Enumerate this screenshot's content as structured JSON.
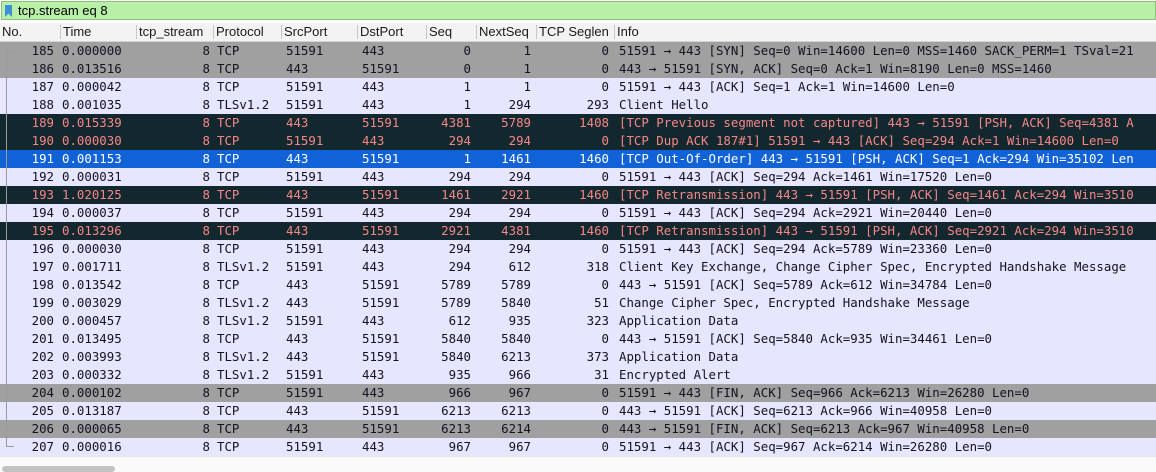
{
  "filter": {
    "value": "tcp.stream eq 8"
  },
  "columns": [
    "No.",
    "Time",
    "tcp_stream",
    "Protocol",
    "SrcPort",
    "DstPort",
    "Seq",
    "NextSeq",
    "TCP Seglen",
    "Info"
  ],
  "colors": {
    "filter_bg": "#b8f0a8",
    "row_normal": "#e7e6ff",
    "row_gray": "#a0a0a0",
    "row_dark": "#12272e",
    "row_dark_text": "#f78787",
    "row_selected": "#1062d6"
  },
  "packets": [
    {
      "no": "185",
      "time": "0.000000",
      "stream": "8",
      "proto": "TCP",
      "src": "51591",
      "dst": "443",
      "seq": "0",
      "next": "1",
      "len": "0",
      "info": "51591 → 443 [SYN] Seq=0 Win=14600 Len=0 MSS=1460 SACK_PERM=1 TSval=21",
      "style": "gray"
    },
    {
      "no": "186",
      "time": "0.013516",
      "stream": "8",
      "proto": "TCP",
      "src": "443",
      "dst": "51591",
      "seq": "0",
      "next": "1",
      "len": "0",
      "info": "443 → 51591 [SYN, ACK] Seq=0 Ack=1 Win=8190 Len=0 MSS=1460",
      "style": "gray"
    },
    {
      "no": "187",
      "time": "0.000042",
      "stream": "8",
      "proto": "TCP",
      "src": "51591",
      "dst": "443",
      "seq": "1",
      "next": "1",
      "len": "0",
      "info": "51591 → 443 [ACK] Seq=1 Ack=1 Win=14600 Len=0",
      "style": "normal"
    },
    {
      "no": "188",
      "time": "0.001035",
      "stream": "8",
      "proto": "TLSv1.2",
      "src": "51591",
      "dst": "443",
      "seq": "1",
      "next": "294",
      "len": "293",
      "info": "Client Hello",
      "style": "normal"
    },
    {
      "no": "189",
      "time": "0.015339",
      "stream": "8",
      "proto": "TCP",
      "src": "443",
      "dst": "51591",
      "seq": "4381",
      "next": "5789",
      "len": "1408",
      "info": "[TCP Previous segment not captured] 443 → 51591 [PSH, ACK] Seq=4381 A",
      "style": "dark"
    },
    {
      "no": "190",
      "time": "0.000030",
      "stream": "8",
      "proto": "TCP",
      "src": "51591",
      "dst": "443",
      "seq": "294",
      "next": "294",
      "len": "0",
      "info": "[TCP Dup ACK 187#1] 51591 → 443 [ACK] Seq=294 Ack=1 Win=14600 Len=0",
      "style": "dark"
    },
    {
      "no": "191",
      "time": "0.001153",
      "stream": "8",
      "proto": "TCP",
      "src": "443",
      "dst": "51591",
      "seq": "1",
      "next": "1461",
      "len": "1460",
      "info": "[TCP Out-Of-Order] 443 → 51591 [PSH, ACK] Seq=1 Ack=294 Win=35102 Len",
      "style": "selected"
    },
    {
      "no": "192",
      "time": "0.000031",
      "stream": "8",
      "proto": "TCP",
      "src": "51591",
      "dst": "443",
      "seq": "294",
      "next": "294",
      "len": "0",
      "info": "51591 → 443 [ACK] Seq=294 Ack=1461 Win=17520 Len=0",
      "style": "normal"
    },
    {
      "no": "193",
      "time": "1.020125",
      "stream": "8",
      "proto": "TCP",
      "src": "443",
      "dst": "51591",
      "seq": "1461",
      "next": "2921",
      "len": "1460",
      "info": "[TCP Retransmission] 443 → 51591 [PSH, ACK] Seq=1461 Ack=294 Win=3510",
      "style": "dark"
    },
    {
      "no": "194",
      "time": "0.000037",
      "stream": "8",
      "proto": "TCP",
      "src": "51591",
      "dst": "443",
      "seq": "294",
      "next": "294",
      "len": "0",
      "info": "51591 → 443 [ACK] Seq=294 Ack=2921 Win=20440 Len=0",
      "style": "normal"
    },
    {
      "no": "195",
      "time": "0.013296",
      "stream": "8",
      "proto": "TCP",
      "src": "443",
      "dst": "51591",
      "seq": "2921",
      "next": "4381",
      "len": "1460",
      "info": "[TCP Retransmission] 443 → 51591 [PSH, ACK] Seq=2921 Ack=294 Win=3510",
      "style": "dark"
    },
    {
      "no": "196",
      "time": "0.000030",
      "stream": "8",
      "proto": "TCP",
      "src": "51591",
      "dst": "443",
      "seq": "294",
      "next": "294",
      "len": "0",
      "info": "51591 → 443 [ACK] Seq=294 Ack=5789 Win=23360 Len=0",
      "style": "normal"
    },
    {
      "no": "197",
      "time": "0.001711",
      "stream": "8",
      "proto": "TLSv1.2",
      "src": "51591",
      "dst": "443",
      "seq": "294",
      "next": "612",
      "len": "318",
      "info": "Client Key Exchange, Change Cipher Spec, Encrypted Handshake Message",
      "style": "normal"
    },
    {
      "no": "198",
      "time": "0.013542",
      "stream": "8",
      "proto": "TCP",
      "src": "443",
      "dst": "51591",
      "seq": "5789",
      "next": "5789",
      "len": "0",
      "info": "443 → 51591 [ACK] Seq=5789 Ack=612 Win=34784 Len=0",
      "style": "normal"
    },
    {
      "no": "199",
      "time": "0.003029",
      "stream": "8",
      "proto": "TLSv1.2",
      "src": "443",
      "dst": "51591",
      "seq": "5789",
      "next": "5840",
      "len": "51",
      "info": "Change Cipher Spec, Encrypted Handshake Message",
      "style": "normal"
    },
    {
      "no": "200",
      "time": "0.000457",
      "stream": "8",
      "proto": "TLSv1.2",
      "src": "51591",
      "dst": "443",
      "seq": "612",
      "next": "935",
      "len": "323",
      "info": "Application Data",
      "style": "normal"
    },
    {
      "no": "201",
      "time": "0.013495",
      "stream": "8",
      "proto": "TCP",
      "src": "443",
      "dst": "51591",
      "seq": "5840",
      "next": "5840",
      "len": "0",
      "info": "443 → 51591 [ACK] Seq=5840 Ack=935 Win=34461 Len=0",
      "style": "normal"
    },
    {
      "no": "202",
      "time": "0.003993",
      "stream": "8",
      "proto": "TLSv1.2",
      "src": "443",
      "dst": "51591",
      "seq": "5840",
      "next": "6213",
      "len": "373",
      "info": "Application Data",
      "style": "normal"
    },
    {
      "no": "203",
      "time": "0.000332",
      "stream": "8",
      "proto": "TLSv1.2",
      "src": "51591",
      "dst": "443",
      "seq": "935",
      "next": "966",
      "len": "31",
      "info": "Encrypted Alert",
      "style": "normal"
    },
    {
      "no": "204",
      "time": "0.000102",
      "stream": "8",
      "proto": "TCP",
      "src": "51591",
      "dst": "443",
      "seq": "966",
      "next": "967",
      "len": "0",
      "info": "51591 → 443 [FIN, ACK] Seq=966 Ack=6213 Win=26280 Len=0",
      "style": "gray"
    },
    {
      "no": "205",
      "time": "0.013187",
      "stream": "8",
      "proto": "TCP",
      "src": "443",
      "dst": "51591",
      "seq": "6213",
      "next": "6213",
      "len": "0",
      "info": "443 → 51591 [ACK] Seq=6213 Ack=966 Win=40958 Len=0",
      "style": "normal"
    },
    {
      "no": "206",
      "time": "0.000065",
      "stream": "8",
      "proto": "TCP",
      "src": "443",
      "dst": "51591",
      "seq": "6213",
      "next": "6214",
      "len": "0",
      "info": "443 → 51591 [FIN, ACK] Seq=6213 Ack=967 Win=40958 Len=0",
      "style": "gray"
    },
    {
      "no": "207",
      "time": "0.000016",
      "stream": "8",
      "proto": "TCP",
      "src": "51591",
      "dst": "443",
      "seq": "967",
      "next": "967",
      "len": "0",
      "info": "51591 → 443 [ACK] Seq=967 Ack=6214 Win=26280 Len=0",
      "style": "normal"
    }
  ]
}
